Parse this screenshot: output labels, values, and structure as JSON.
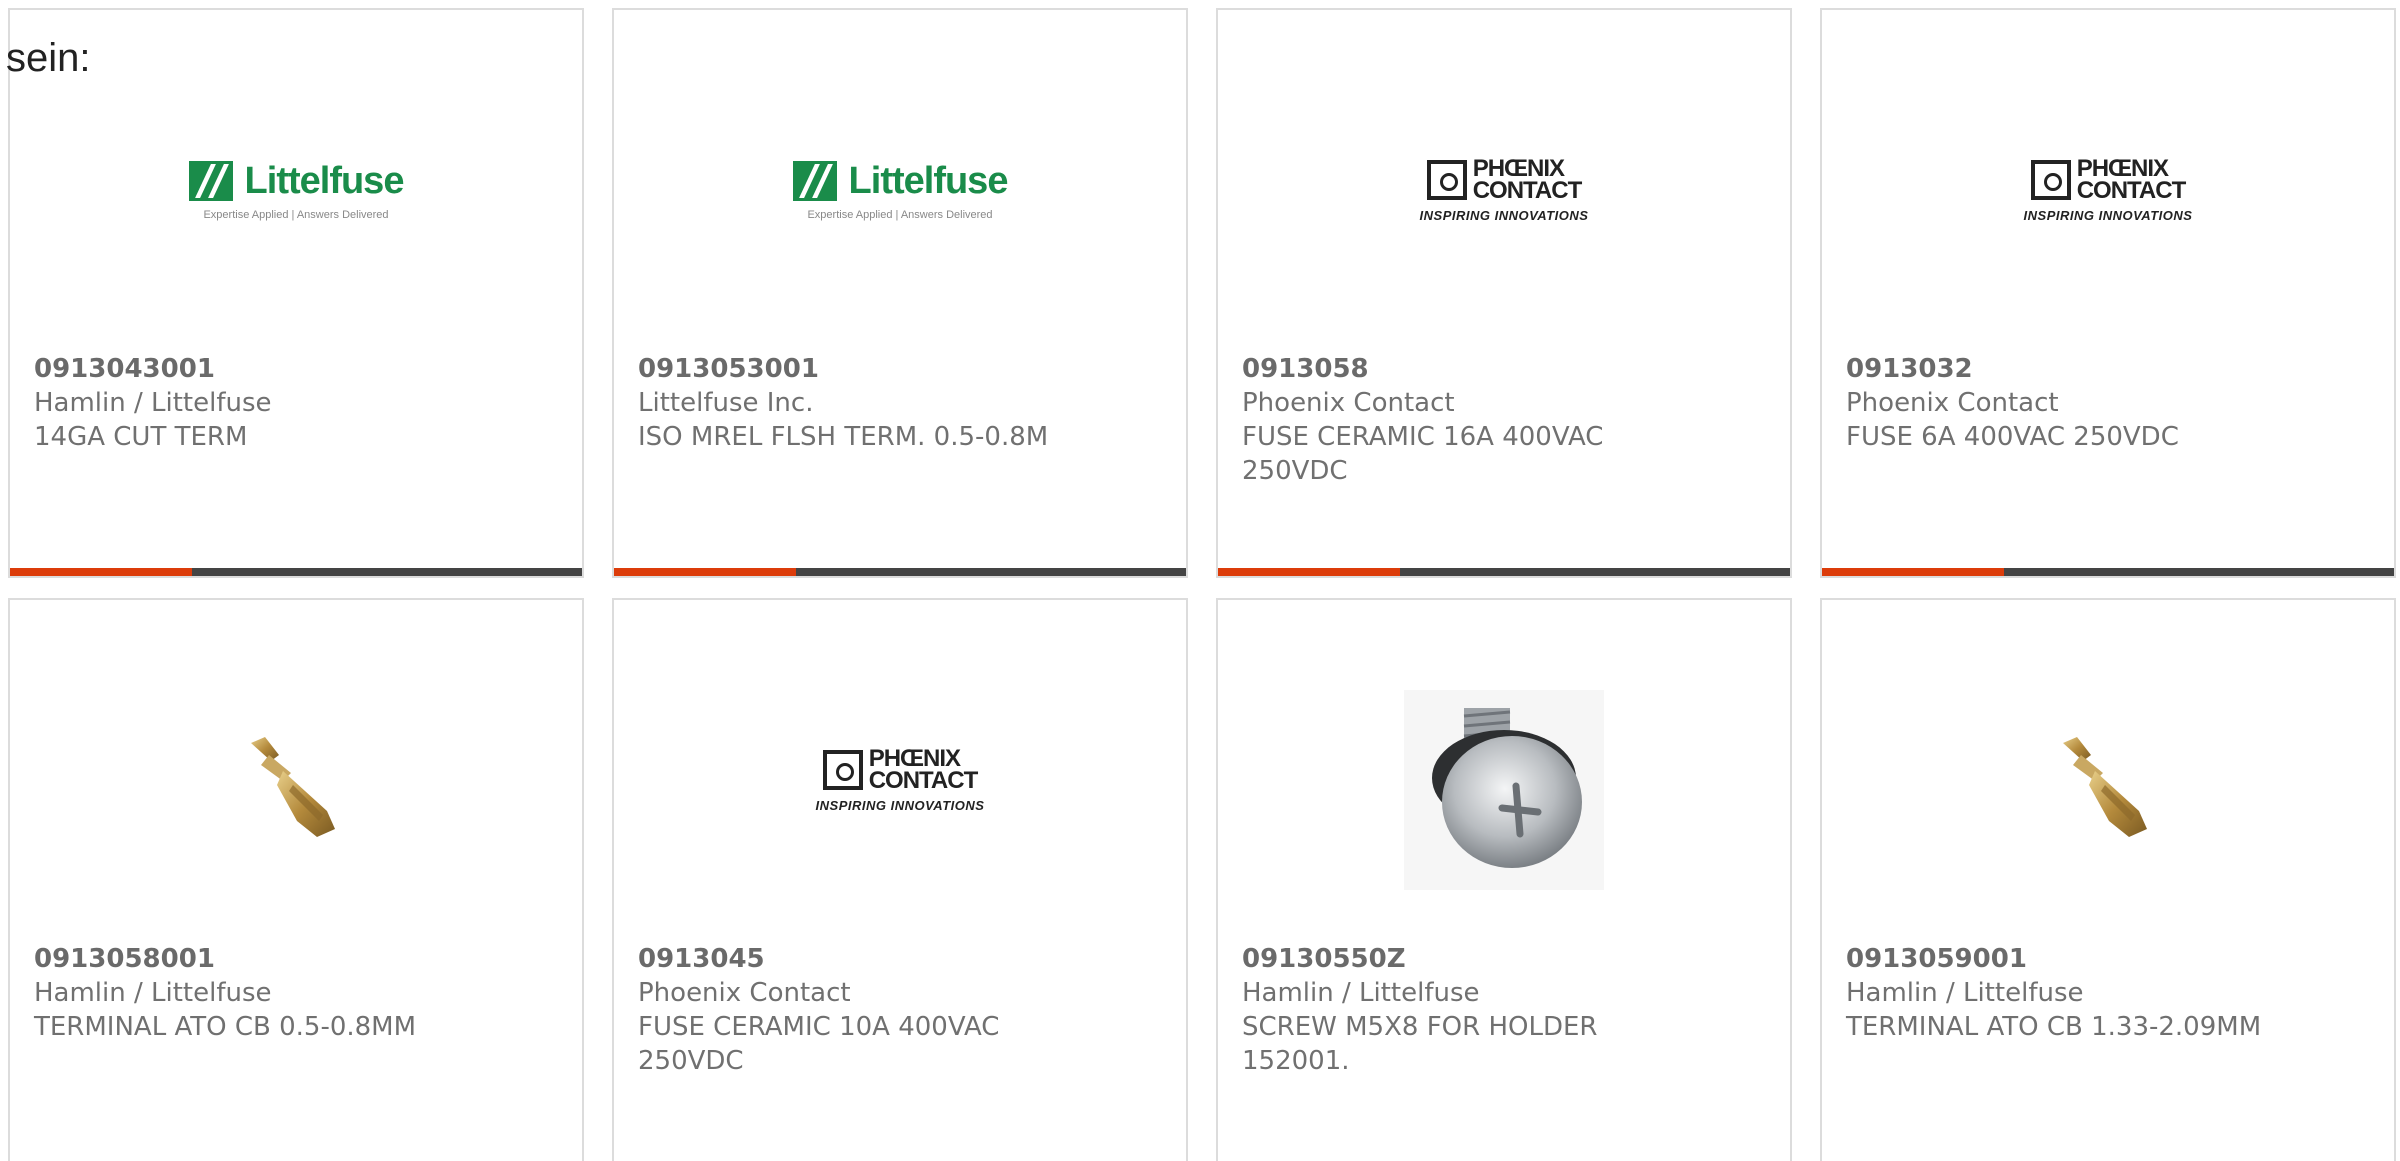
{
  "intro_text": "sein:",
  "brand_colors": {
    "accent": "#dc3c0a",
    "bar": "#444444",
    "littelfuse_green": "#1a8c4a"
  },
  "logos": {
    "littelfuse": {
      "name": "Littelfuse",
      "tagline": "Expertise Applied | Answers Delivered"
    },
    "phoenix": {
      "line1": "PHŒNIX",
      "line2": "CONTACT",
      "tagline": "INSPIRING INNOVATIONS"
    }
  },
  "products": [
    {
      "image": "littelfuse-logo",
      "part_number": "0913043001",
      "manufacturer": "Hamlin / Littelfuse",
      "description": "14GA CUT TERM"
    },
    {
      "image": "littelfuse-logo",
      "part_number": "0913053001",
      "manufacturer": "Littelfuse Inc.",
      "description": "ISO MREL FLSH TERM. 0.5-0.8M"
    },
    {
      "image": "phoenix-contact-logo",
      "part_number": "0913058",
      "manufacturer": "Phoenix Contact",
      "description": "FUSE CERAMIC 16A 400VAC 250VDC"
    },
    {
      "image": "phoenix-contact-logo",
      "part_number": "0913032",
      "manufacturer": "Phoenix Contact",
      "description": "FUSE 6A 400VAC 250VDC"
    },
    {
      "image": "terminal-photo",
      "part_number": "0913058001",
      "manufacturer": "Hamlin / Littelfuse",
      "description": "TERMINAL ATO CB 0.5-0.8MM"
    },
    {
      "image": "phoenix-contact-logo",
      "part_number": "0913045",
      "manufacturer": "Phoenix Contact",
      "description": "FUSE CERAMIC 10A 400VAC 250VDC"
    },
    {
      "image": "screw-photo",
      "part_number": "09130550Z",
      "manufacturer": "Hamlin / Littelfuse",
      "description": "SCREW M5X8 FOR HOLDER 152001."
    },
    {
      "image": "terminal-photo",
      "part_number": "0913059001",
      "manufacturer": "Hamlin / Littelfuse",
      "description": "TERMINAL ATO CB 1.33-2.09MM"
    }
  ]
}
